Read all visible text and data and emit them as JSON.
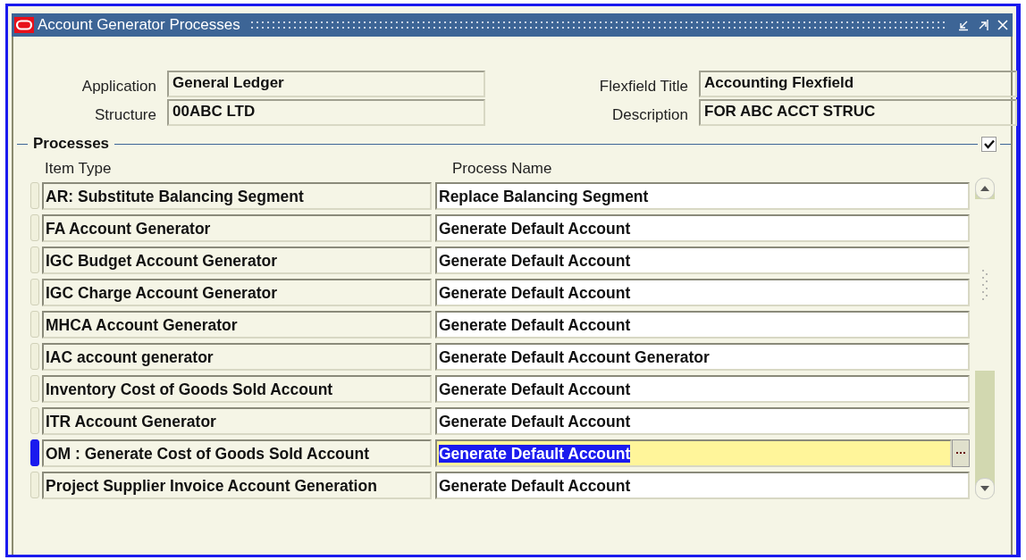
{
  "window": {
    "title": "Account Generator Processes"
  },
  "header_fields": [
    {
      "label": "Application",
      "value": "General Ledger"
    },
    {
      "label": "Flexfield Title",
      "value": "Accounting Flexfield"
    },
    {
      "label": "Structure",
      "value": "00ABC LTD"
    },
    {
      "label": "Description",
      "value": "FOR ABC ACCT STRUC"
    }
  ],
  "processes": {
    "title": "Processes",
    "checked": true,
    "columns": [
      "Item Type",
      "Process Name"
    ],
    "rows": [
      {
        "item_type": "AR: Substitute Balancing Segment",
        "process_name": "Replace Balancing Segment",
        "selected": false
      },
      {
        "item_type": "FA Account Generator",
        "process_name": "Generate Default Account",
        "selected": false
      },
      {
        "item_type": "IGC Budget Account Generator",
        "process_name": "Generate Default Account",
        "selected": false
      },
      {
        "item_type": "IGC Charge Account Generator",
        "process_name": "Generate Default Account",
        "selected": false
      },
      {
        "item_type": "MHCA Account Generator",
        "process_name": "Generate Default Account",
        "selected": false
      },
      {
        "item_type": "IAC account generator",
        "process_name": "Generate Default Account Generator",
        "selected": false
      },
      {
        "item_type": "Inventory Cost of Goods Sold Account",
        "process_name": "Generate Default Account",
        "selected": false
      },
      {
        "item_type": "ITR Account Generator",
        "process_name": "Generate Default Account",
        "selected": false
      },
      {
        "item_type": "OM : Generate Cost of Goods Sold Account",
        "process_name": "Generate Default Account",
        "selected": true
      },
      {
        "item_type": "Project Supplier Invoice Account Generation",
        "process_name": "Generate Default Account",
        "selected": false
      }
    ]
  }
}
